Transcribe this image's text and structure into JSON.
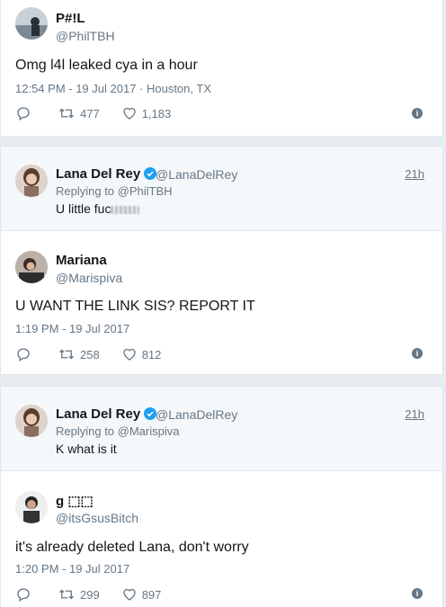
{
  "tweet1": {
    "name": "P#!L",
    "handle": "@PhilTBH",
    "text": "Omg l4l leaked cya in a hour",
    "meta": "12:54 PM - 19 Jul 2017 · Houston, TX",
    "retweets": "477",
    "likes": "1,183"
  },
  "reply1": {
    "name": "Lana Del Rey",
    "handle": "@LanaDelRey",
    "time": "21h",
    "replying": "Replying to @PhilTBH",
    "text": "U little fuc"
  },
  "tweet2": {
    "name": "Mariana",
    "handle": "@Marispiva",
    "text": "U WANT THE LINK SIS? REPORT IT",
    "meta": "1:19 PM - 19 Jul 2017",
    "retweets": "258",
    "likes": "812"
  },
  "reply2": {
    "name": "Lana Del Rey",
    "handle": "@LanaDelRey",
    "time": "21h",
    "replying": "Replying to @Marispiva",
    "text": "K what is it"
  },
  "tweet3": {
    "name": "g ⬚⬚",
    "handle": "@itsGsusBitch",
    "text": "it's already deleted Lana, don't worry",
    "meta": "1:20 PM - 19 Jul 2017",
    "retweets": "299",
    "likes": "897"
  },
  "icons": {
    "reply": "reply-icon",
    "retweet": "retweet-icon",
    "like": "heart-icon",
    "info": "info-icon",
    "verified": "verified-badge-icon"
  },
  "colors": {
    "verified": "#1da1f2",
    "muted": "#657786",
    "reply_bg": "#f5f8fa"
  }
}
